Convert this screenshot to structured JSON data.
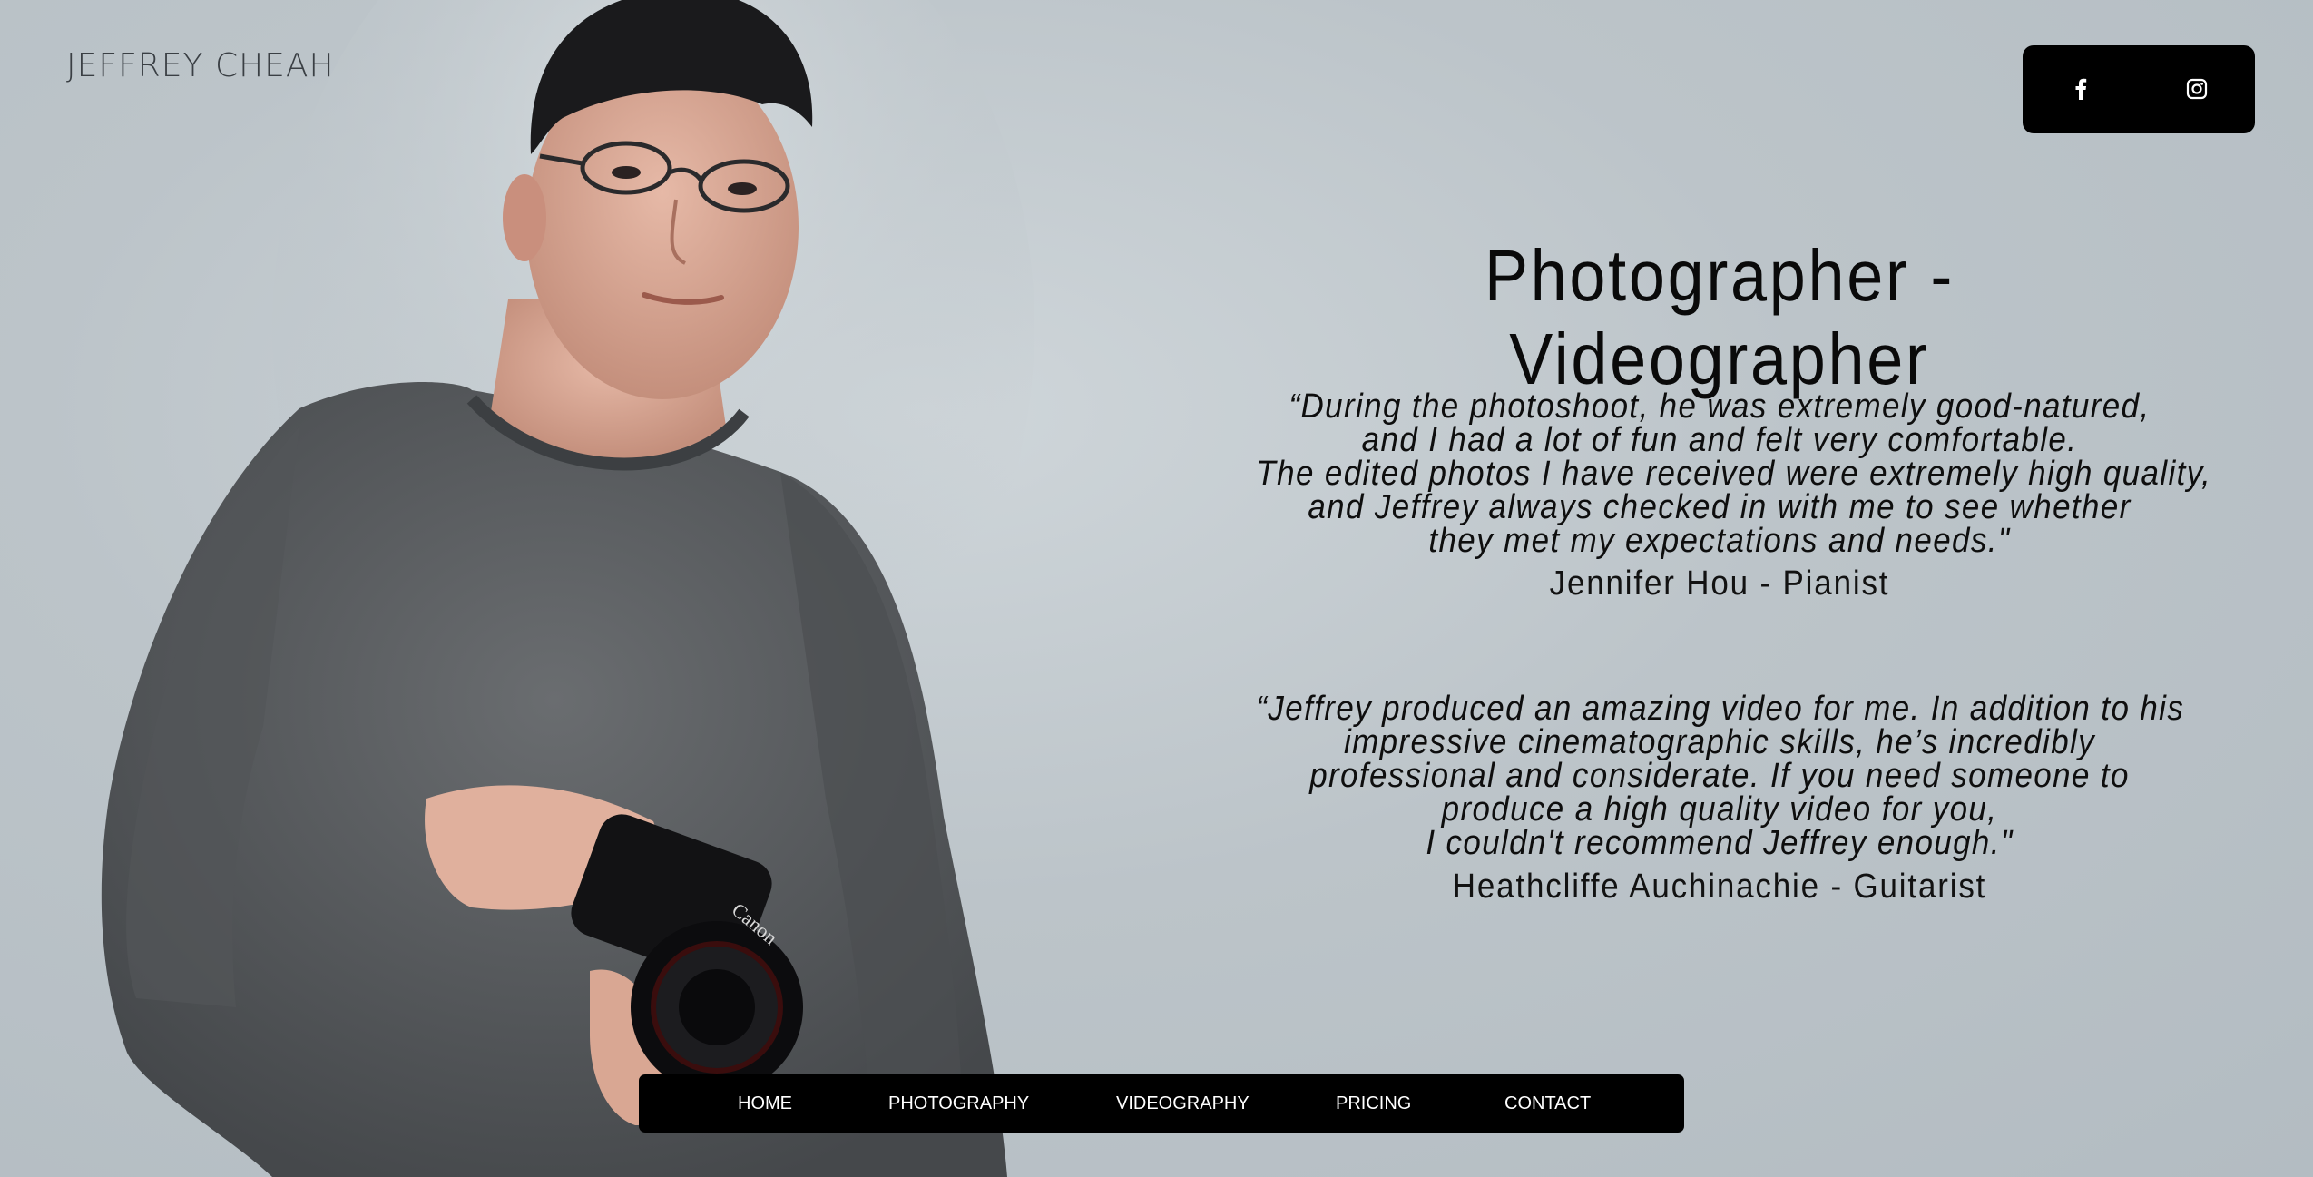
{
  "brand": {
    "name": "JEFFREY CHEAH"
  },
  "social": [
    {
      "icon": "facebook-icon"
    },
    {
      "icon": "instagram-icon"
    }
  ],
  "headline": "Photographer - Videographer",
  "testimonials": [
    {
      "lines": [
        "“During the photoshoot, he was extremely good-natured,",
        "and I had a lot of fun and felt very comfortable.",
        "The edited photos I have received were extremely high quality,",
        "and Jeffrey always checked in with me to see whether",
        "they met my expectations and needs.\""
      ],
      "author": "Jennifer Hou - Pianist"
    },
    {
      "lines": [
        "“Jeffrey produced an amazing video for me. In addition to his",
        "impressive cinematographic skills, he’s incredibly",
        "professional and considerate. If you need someone to",
        "produce a high quality video for you,",
        "I couldn't recommend Jeffrey enough.\""
      ],
      "author": "Heathcliffe Auchinachie - Guitarist"
    }
  ],
  "nav": {
    "items": [
      "HOME",
      "PHOTOGRAPHY",
      "VIDEOGRAPHY",
      "PRICING",
      "CONTACT"
    ]
  },
  "colors": {
    "background": "#bcc4c9",
    "text": "#0a0a0a",
    "bar": "#000000",
    "bar_text": "#ffffff"
  }
}
